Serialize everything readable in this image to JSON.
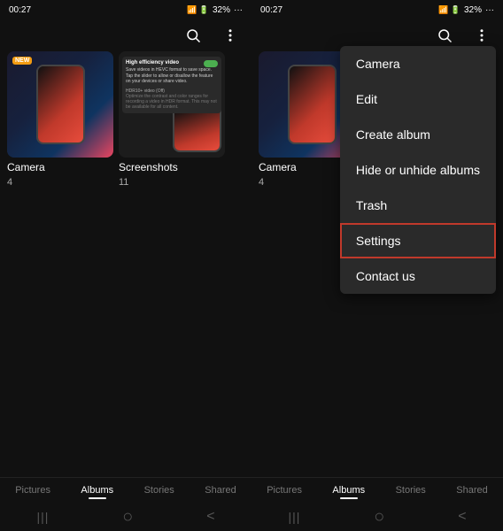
{
  "left_panel": {
    "status_bar": {
      "time": "00:27",
      "battery": "32%",
      "signal": "▲▲▲▂"
    },
    "albums": [
      {
        "name": "Camera",
        "count": "4",
        "badge": "NEW"
      },
      {
        "name": "Screenshots",
        "count": "11"
      }
    ],
    "tabs": [
      "Pictures",
      "Albums",
      "Stories",
      "Shared"
    ],
    "active_tab": "Albums"
  },
  "right_panel": {
    "status_bar": {
      "time": "00:27",
      "battery": "32%"
    },
    "albums": [
      {
        "name": "Camera",
        "count": "4"
      }
    ],
    "menu": {
      "items": [
        {
          "label": "Camera",
          "highlighted": false
        },
        {
          "label": "Edit",
          "highlighted": false
        },
        {
          "label": "Create album",
          "highlighted": false
        },
        {
          "label": "Hide or unhide albums",
          "highlighted": false
        },
        {
          "label": "Trash",
          "highlighted": false
        },
        {
          "label": "Settings",
          "highlighted": true
        },
        {
          "label": "Contact us",
          "highlighted": false
        }
      ]
    },
    "tabs": [
      "Pictures",
      "Albums",
      "Stories",
      "Shared"
    ],
    "active_tab": "Albums"
  },
  "icons": {
    "search": "🔍",
    "more": "⋮",
    "nav_menu": "|||",
    "nav_home": "○",
    "nav_back": "<"
  }
}
